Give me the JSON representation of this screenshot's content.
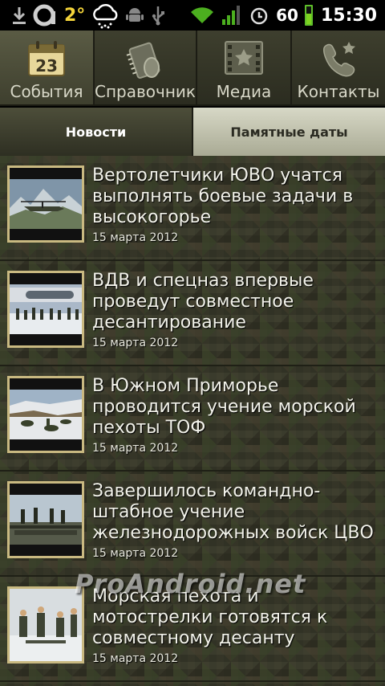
{
  "status_bar": {
    "temperature": "2°",
    "battery_level": "60",
    "battery_fraction": 0.6,
    "time": "15:30",
    "icons": [
      "download-icon",
      "app-a-icon",
      "weather-icon",
      "android-debug-icon",
      "usb-icon",
      "wifi-icon",
      "signal-icon",
      "alarm-icon",
      "battery-icon"
    ]
  },
  "top_tabs": [
    {
      "label": "События",
      "icon": "calendar-icon",
      "calendar_day": "23"
    },
    {
      "label": "Справочник",
      "icon": "directory-icon"
    },
    {
      "label": "Медиа",
      "icon": "film-star-icon"
    },
    {
      "label": "Контакты",
      "icon": "phone-star-icon"
    }
  ],
  "sub_tabs": [
    {
      "label": "Новости"
    },
    {
      "label": "Памятные даты"
    }
  ],
  "news": [
    {
      "title": "Вертолетчики ЮВО учатся выполнять боевые задачи в высокогорье",
      "date": "15 марта 2012"
    },
    {
      "title": "ВДВ и спецназ впервые проведут совместное десантирование",
      "date": "15 марта 2012"
    },
    {
      "title": "В Южном Приморье проводится учение морской пехоты ТОФ",
      "date": "15 марта 2012"
    },
    {
      "title": "Завершилось командно-штабное учение железнодорожных войск ЦВО",
      "date": "15 марта 2012"
    },
    {
      "title": "Морская пехота и мотострелки готовятся к совместному десанту",
      "date": "15 марта 2012"
    }
  ],
  "watermark": "ProAndroid.net",
  "colors": {
    "accent_yellow": "#f4d43a",
    "battery_green": "#7ed321",
    "thumb_border": "#c9b981"
  }
}
